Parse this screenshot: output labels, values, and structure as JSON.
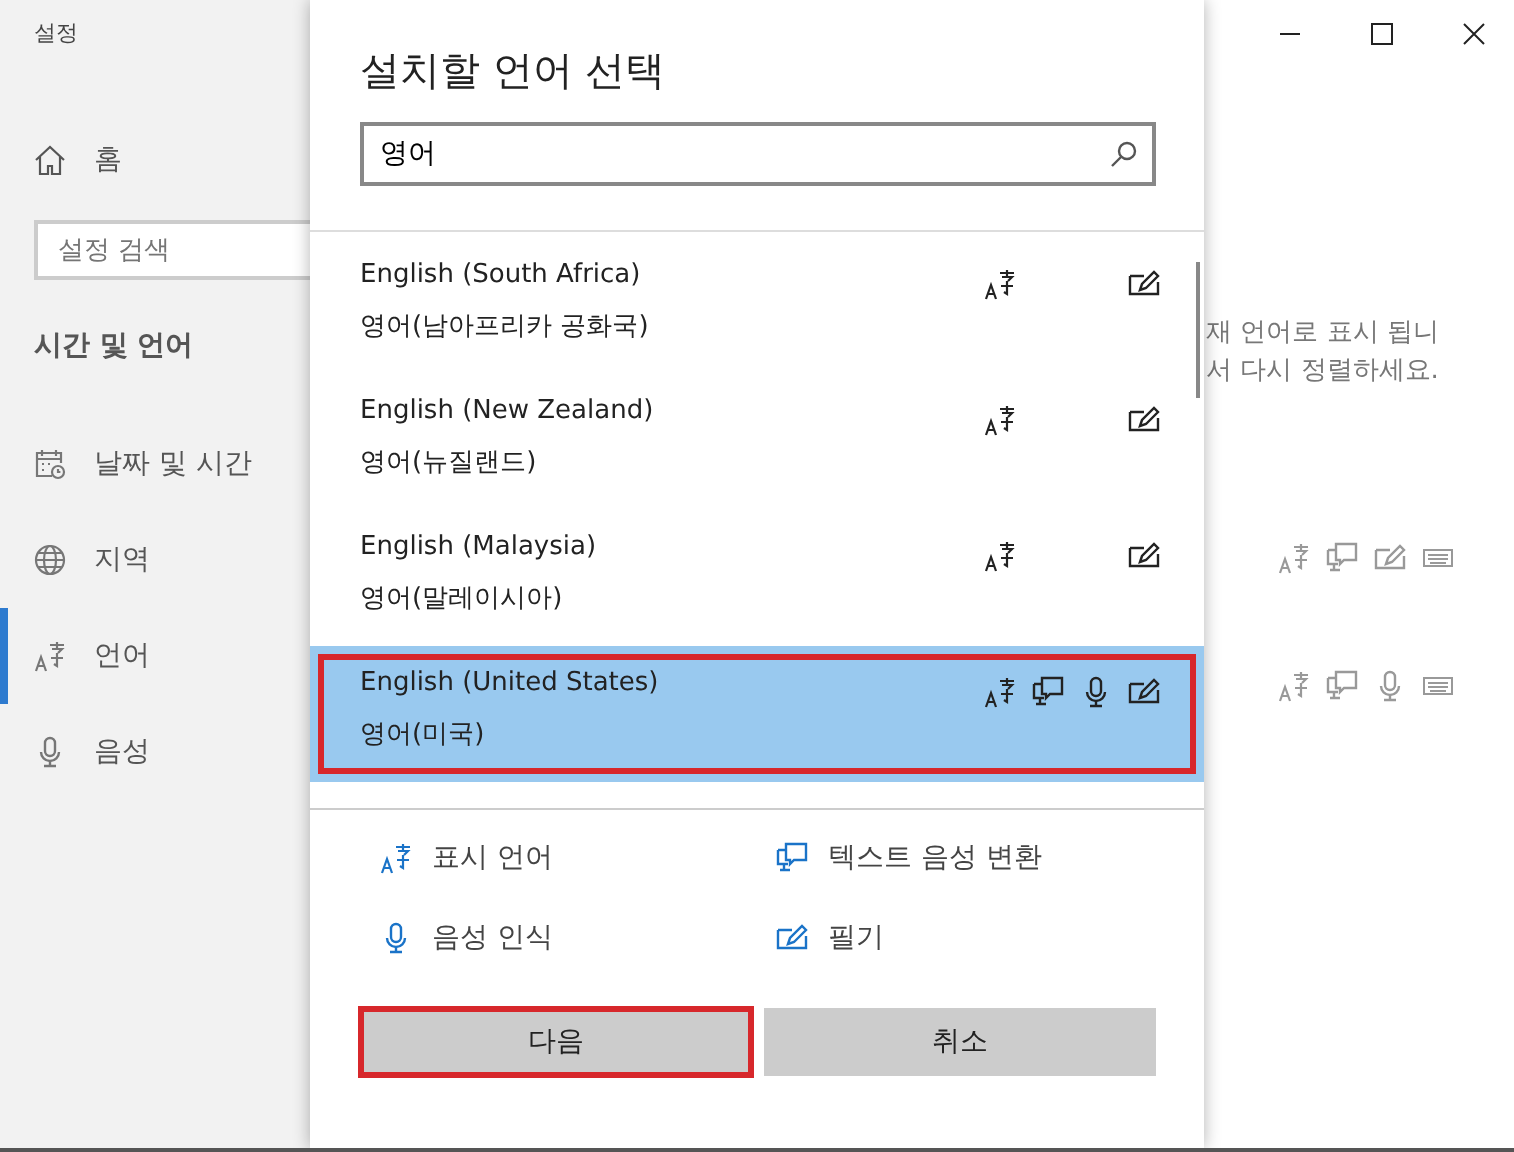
{
  "settings_window": {
    "title": "설정",
    "home": "홈",
    "search": {
      "placeholder": "설정 검색"
    },
    "section_title": "시간 및 언어",
    "nav_items": [
      {
        "label": "날짜 및 시간",
        "selected": false
      },
      {
        "label": "지역",
        "selected": false
      },
      {
        "label": "언어",
        "selected": true
      },
      {
        "label": "음성",
        "selected": false
      }
    ],
    "content_lines": [
      "재 언어로 표시 됩니",
      "서 다시 정렬하세요."
    ],
    "feature_rows": [
      {
        "display": true,
        "tts": true,
        "speech": false,
        "handwriting": true,
        "keyboard": true
      },
      {
        "display": true,
        "tts": true,
        "speech": true,
        "handwriting": false,
        "keyboard": true
      }
    ]
  },
  "dialog": {
    "title": "설치할 언어 선택",
    "search": {
      "value": "영어"
    },
    "languages": [
      {
        "name": "English (South Africa)",
        "native": "영어(남아프리카 공화국)",
        "display": true,
        "tts": false,
        "speech": false,
        "handwriting": true,
        "selected": false,
        "outlined": false
      },
      {
        "name": "English (New Zealand)",
        "native": "영어(뉴질랜드)",
        "display": true,
        "tts": false,
        "speech": false,
        "handwriting": true,
        "selected": false,
        "outlined": false
      },
      {
        "name": "English (Malaysia)",
        "native": "영어(말레이시아)",
        "display": true,
        "tts": false,
        "speech": false,
        "handwriting": true,
        "selected": false,
        "outlined": false
      },
      {
        "name": "English (United States)",
        "native": "영어(미국)",
        "display": true,
        "tts": true,
        "speech": true,
        "handwriting": true,
        "selected": true,
        "outlined": true
      }
    ],
    "legend": [
      {
        "kind": "display",
        "label": "표시 언어"
      },
      {
        "kind": "tts",
        "label": "텍스트 음성 변환"
      },
      {
        "kind": "speech",
        "label": "음성 인식"
      },
      {
        "kind": "handwriting",
        "label": "필기"
      }
    ],
    "buttons": [
      {
        "label": "다음",
        "outlined": true
      },
      {
        "label": "취소",
        "outlined": false
      }
    ]
  }
}
